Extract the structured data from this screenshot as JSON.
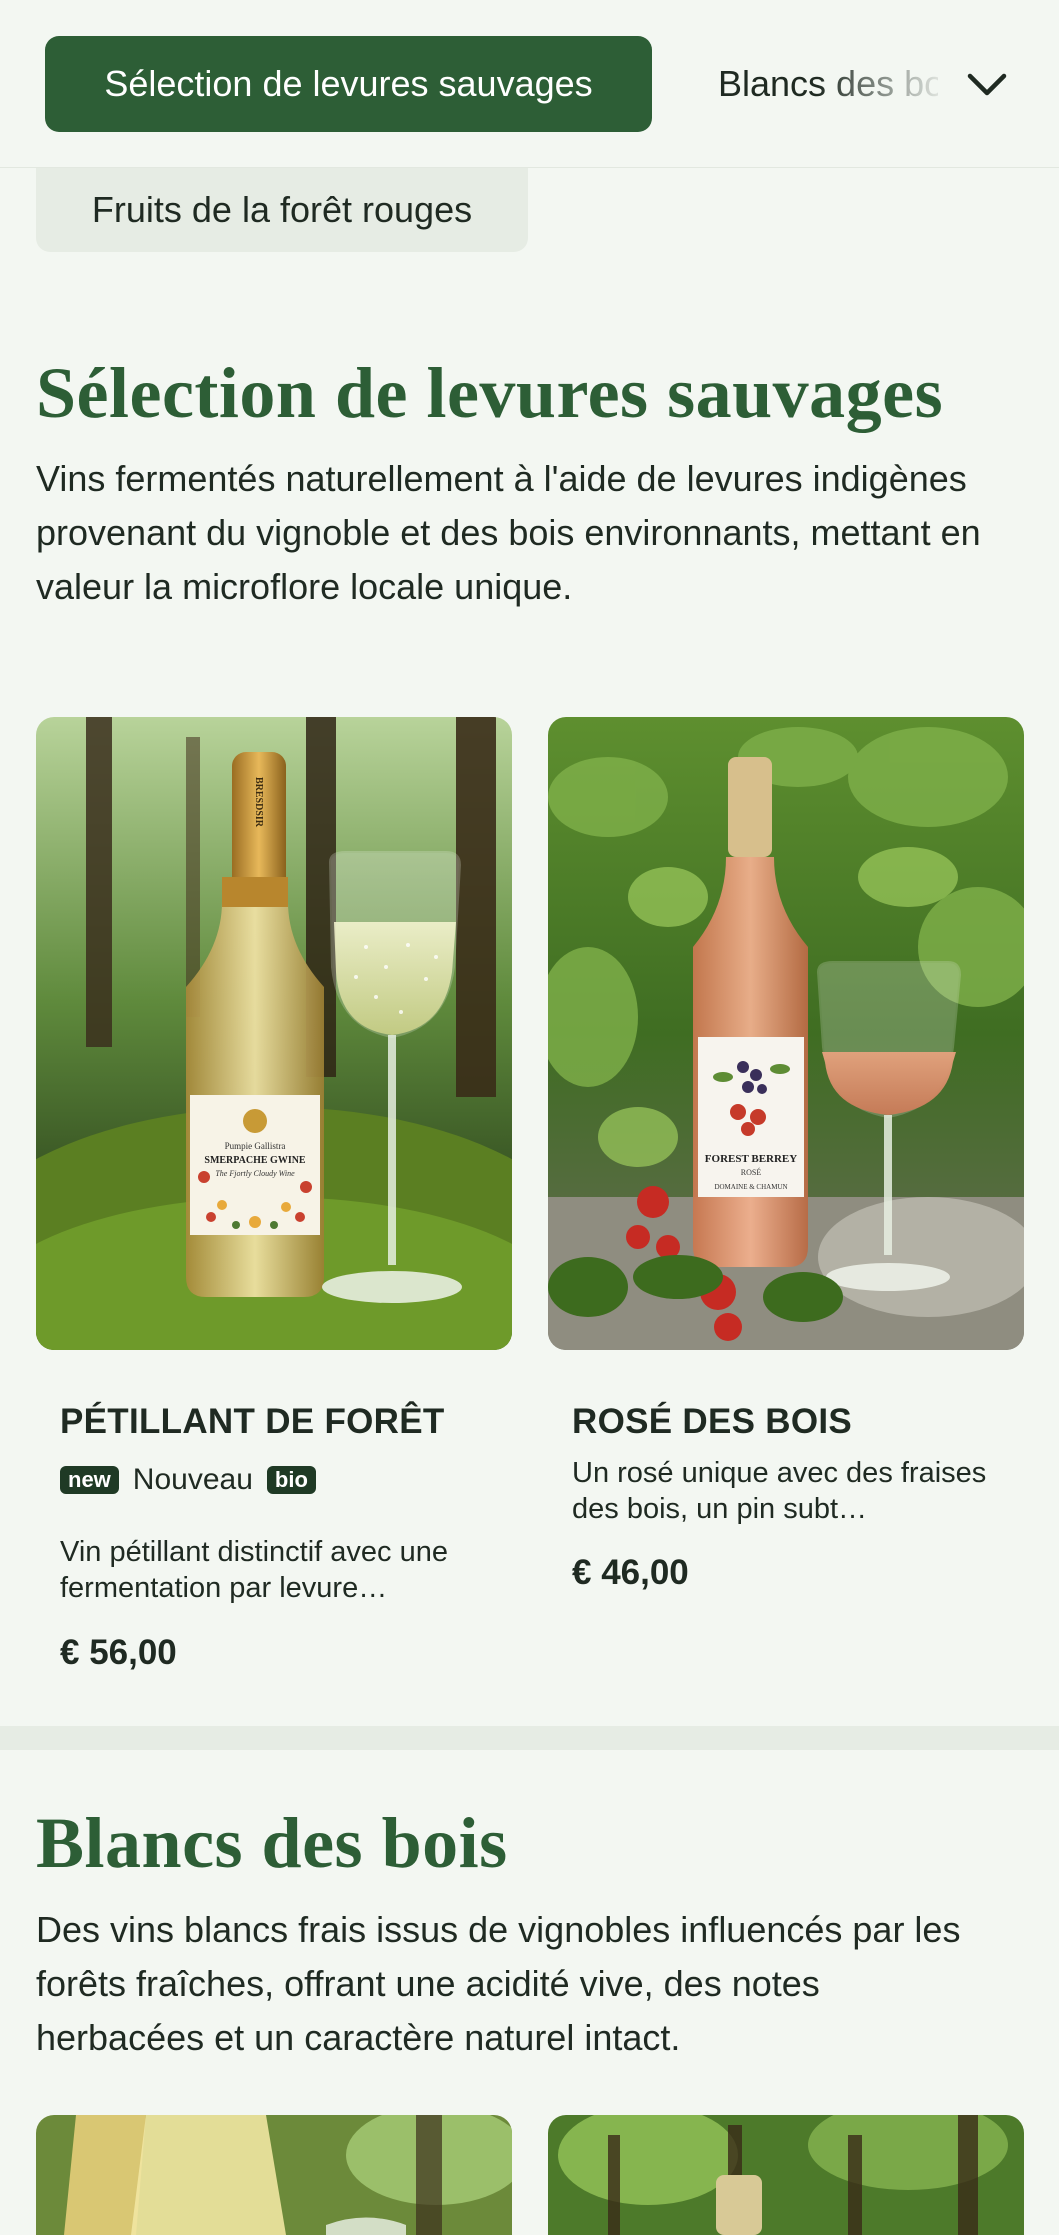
{
  "nav": {
    "active_category": "Sélection de levures sauvages",
    "next_category": "Blancs des bois",
    "second_row_category": "Fruits de la forêt rouges"
  },
  "sections": [
    {
      "title": "Sélection de levures sauvages",
      "description": "Vins fermentés naturellement à l'aide de levures indigènes provenant du vignoble et des bois environnants, mettant en valeur la microflore locale unique.",
      "products": [
        {
          "name": "PÉTILLANT DE FORÊT",
          "tag_new": "new",
          "tag_new_label": "Nouveau",
          "tag_bio": "bio",
          "description": "Vin pétillant distinctif avec une fermentation par levure…",
          "price": "€ 56,00",
          "label_brand": "Pumpie Gallistra",
          "label_name": "SMERPACHE GWINE",
          "label_sub": "The Fjortly Cloudy Wine",
          "neck_text": "BRESDSIR"
        },
        {
          "name": "ROSÉ DES BOIS",
          "description": "Un rosé unique avec des fraises des bois, un pin subt…",
          "price": "€ 46,00",
          "label_name": "FOREST BERREY",
          "label_sub": "ROSÉ",
          "label_house": "DOMAINE & CHAMUN"
        }
      ]
    },
    {
      "title": "Blancs des bois",
      "description": "Des vins blancs frais issus de vignobles influencés par les forêts fraîches, offrant une acidité vive, des notes herbacées et un caractère naturel intact."
    }
  ],
  "colors": {
    "brand_green": "#2d5e36",
    "background": "#f3f7f2",
    "chip_bg": "#e6ece4"
  },
  "icons": [
    "chevron-down-icon"
  ]
}
